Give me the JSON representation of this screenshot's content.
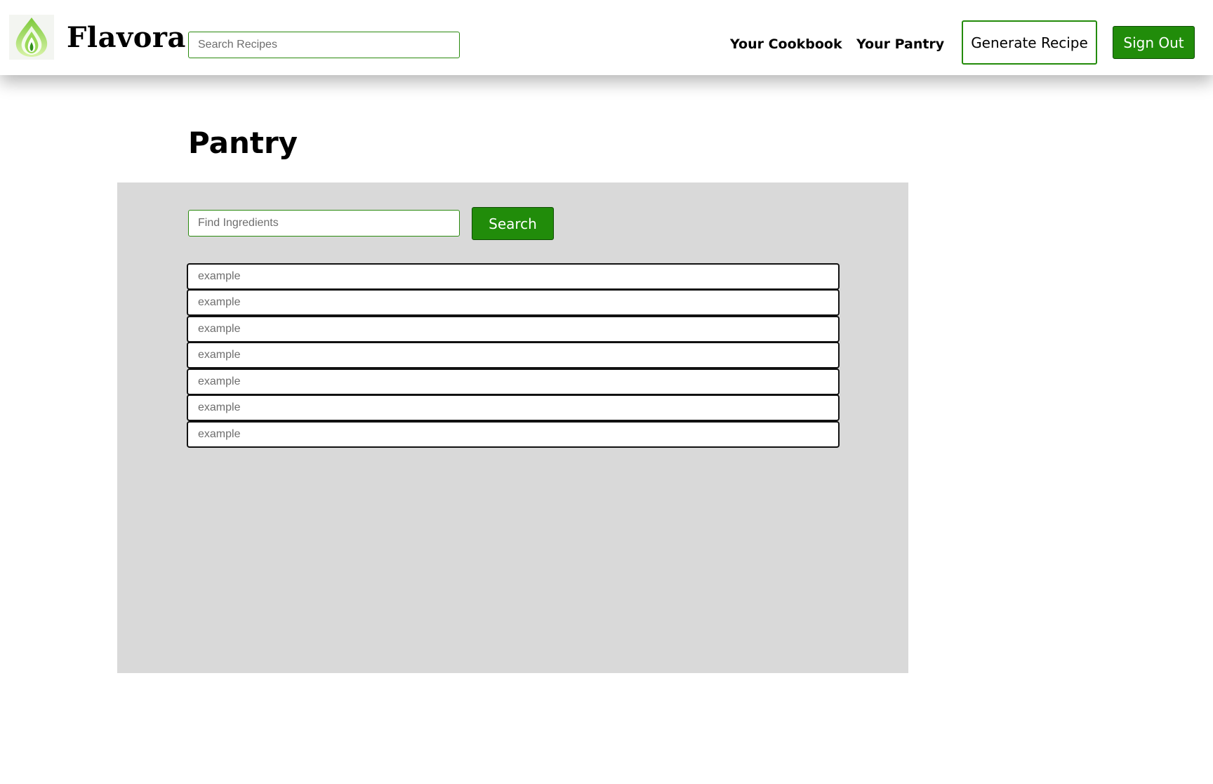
{
  "brand": {
    "name": "Flavora",
    "logo_icon": "leaf-drop-logo-icon",
    "colors": {
      "primary_green": "#218c0a",
      "logo_green_light": "#a6e05a",
      "logo_green_dark": "#2f8f1a"
    }
  },
  "header": {
    "search_placeholder": "Search Recipes",
    "nav": {
      "cookbook_label": "Your Cookbook",
      "pantry_label": "Your Pantry"
    },
    "generate_label": "Generate Recipe",
    "signout_label": "Sign Out"
  },
  "main": {
    "title": "Pantry",
    "panel_color": "#d9d9d9",
    "find_placeholder": "Find Ingredients",
    "search_button_label": "Search",
    "ingredients": [
      "example",
      "example",
      "example",
      "example",
      "example",
      "example",
      "example"
    ]
  }
}
